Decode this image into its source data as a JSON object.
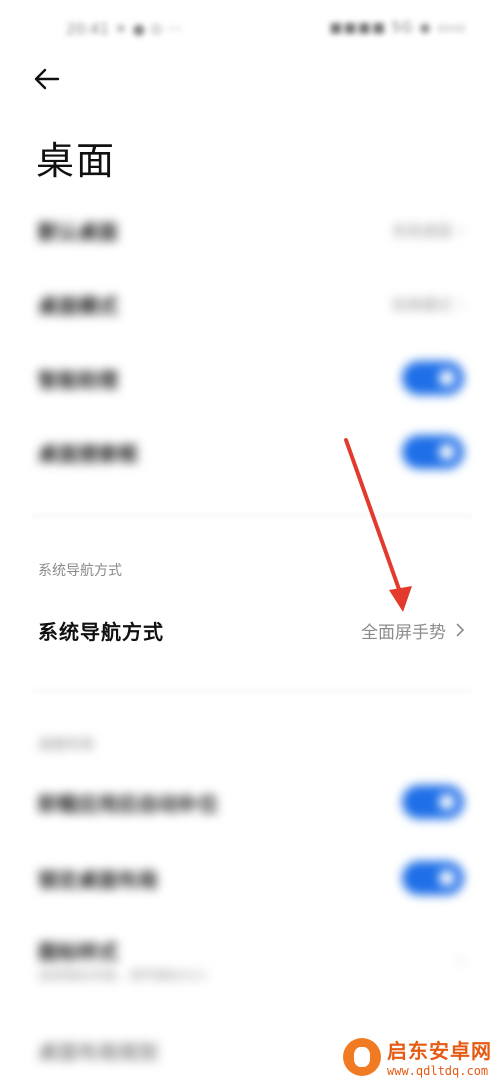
{
  "status_bar": {
    "time": "20:41 ☀ ●  ⊙  ···",
    "icons": "■■■■ 5G ◉ ▭▭"
  },
  "header": {
    "title": "桌面"
  },
  "desktop_settings": [
    {
      "label": "默认桌面",
      "value": "系统桌面",
      "type": "link"
    },
    {
      "label": "桌面模式",
      "value": "经典模式",
      "type": "link"
    },
    {
      "label": "智能助理",
      "type": "toggle",
      "on": true
    },
    {
      "label": "桌面搜索框",
      "type": "toggle",
      "on": true
    }
  ],
  "navigation": {
    "section_header": "系统导航方式",
    "row_label": "系统导航方式",
    "row_value": "全面屏手势"
  },
  "layout_section": {
    "header": "桌面布局",
    "items": [
      {
        "label": "卸载应用后自动补位",
        "type": "toggle",
        "on": true
      },
      {
        "label": "锁定桌面布局",
        "type": "toggle",
        "on": true
      },
      {
        "label": "图标样式",
        "subtitle": "选择图标风格，调节图标大小",
        "type": "link"
      },
      {
        "label": "桌面布局规划",
        "type": "link"
      }
    ]
  },
  "annotation": {
    "arrow_color": "#e23b2e"
  },
  "watermark": {
    "title": "启东安卓网",
    "url": "www.qdltdq.com",
    "brand_color": "#e55b14"
  }
}
